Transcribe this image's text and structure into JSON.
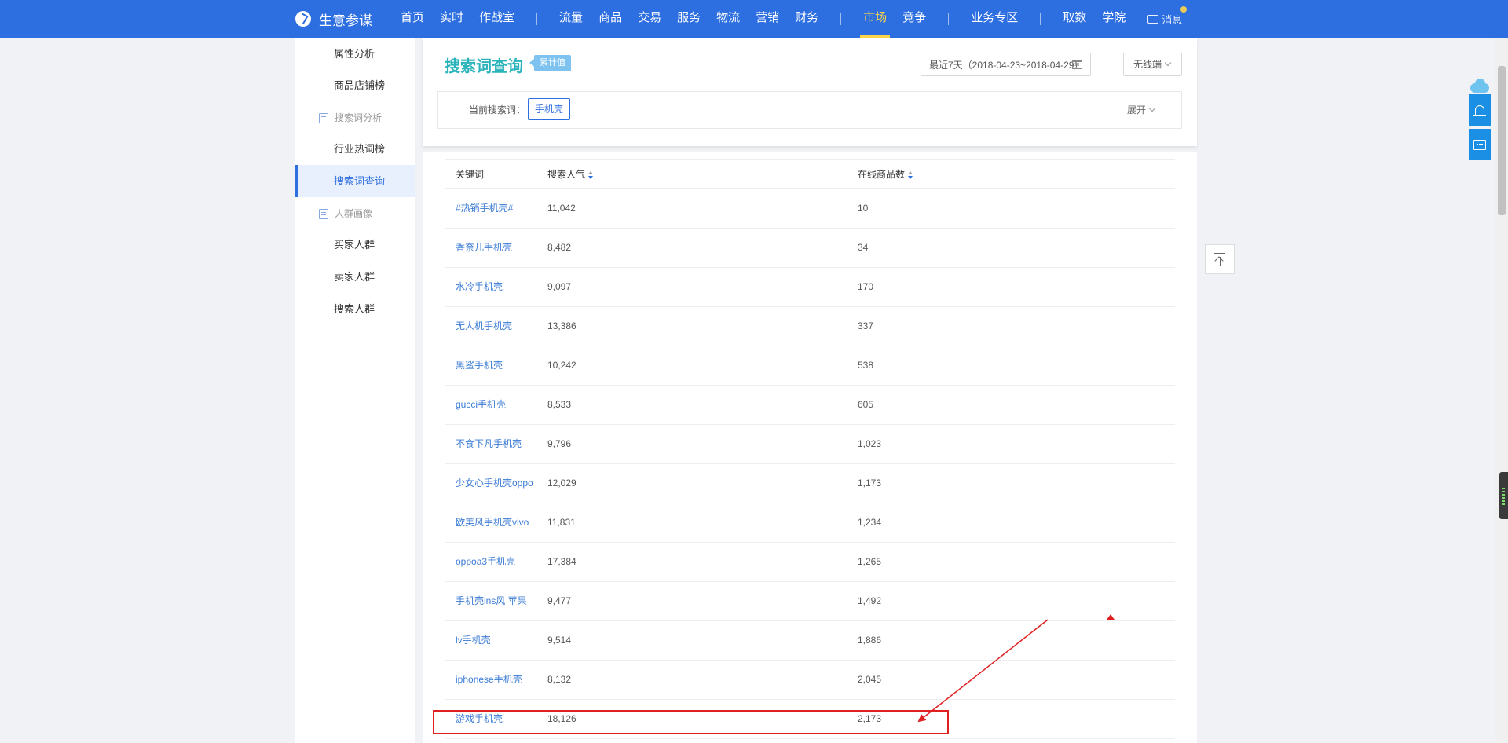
{
  "nav": {
    "brand": "生意参谋",
    "items": [
      "首页",
      "实时",
      "作战室",
      "|",
      "流量",
      "商品",
      "交易",
      "服务",
      "物流",
      "营销",
      "财务",
      "|",
      "市场",
      "竞争",
      "|",
      "业务专区",
      "|",
      "取数",
      "学院"
    ],
    "active": "市场",
    "message": "消息"
  },
  "sidebar": {
    "items": [
      {
        "label": "属性分析",
        "type": "item"
      },
      {
        "label": "商品店铺榜",
        "type": "item"
      },
      {
        "label": "搜索词分析",
        "type": "group"
      },
      {
        "label": "行业热词榜",
        "type": "item"
      },
      {
        "label": "搜索词查询",
        "type": "item",
        "active": true
      },
      {
        "label": "人群画像",
        "type": "group"
      },
      {
        "label": "买家人群",
        "type": "item"
      },
      {
        "label": "卖家人群",
        "type": "item"
      },
      {
        "label": "搜索人群",
        "type": "item"
      }
    ]
  },
  "header": {
    "title": "搜索词查询",
    "tag": "累计值",
    "date_range": "最近7天（2018-04-23~2018-04-29）",
    "calendar_day": "18",
    "device": "无线端"
  },
  "search": {
    "label": "当前搜索词：",
    "term": "手机壳",
    "expand": "展开"
  },
  "table": {
    "headers": [
      "关键词",
      "搜索人气",
      "在线商品数"
    ],
    "rows": [
      [
        "#热销手机壳#",
        "11,042",
        "10"
      ],
      [
        "香奈儿手机壳",
        "8,482",
        "34"
      ],
      [
        "水冷手机壳",
        "9,097",
        "170"
      ],
      [
        "无人机手机壳",
        "13,386",
        "337"
      ],
      [
        "黑鲨手机壳",
        "10,242",
        "538"
      ],
      [
        "gucci手机壳",
        "8,533",
        "605"
      ],
      [
        "不食下凡手机壳",
        "9,796",
        "1,023"
      ],
      [
        "少女心手机壳oppo",
        "12,029",
        "1,173"
      ],
      [
        "欧美风手机壳vivo",
        "11,831",
        "1,234"
      ],
      [
        "oppoa3手机壳",
        "17,384",
        "1,265"
      ],
      [
        "手机壳ins风 苹果",
        "9,477",
        "1,492"
      ],
      [
        "lv手机壳",
        "9,514",
        "1,886"
      ],
      [
        "iphonese手机壳",
        "8,132",
        "2,045"
      ],
      [
        "游戏手机壳",
        "18,126",
        "2,173"
      ]
    ]
  },
  "annotation_color": "#e02020",
  "theme": {
    "nav_bg": "#2d6ee0",
    "accent": "#2d6ee0",
    "title_color": "#2bb3bb"
  }
}
